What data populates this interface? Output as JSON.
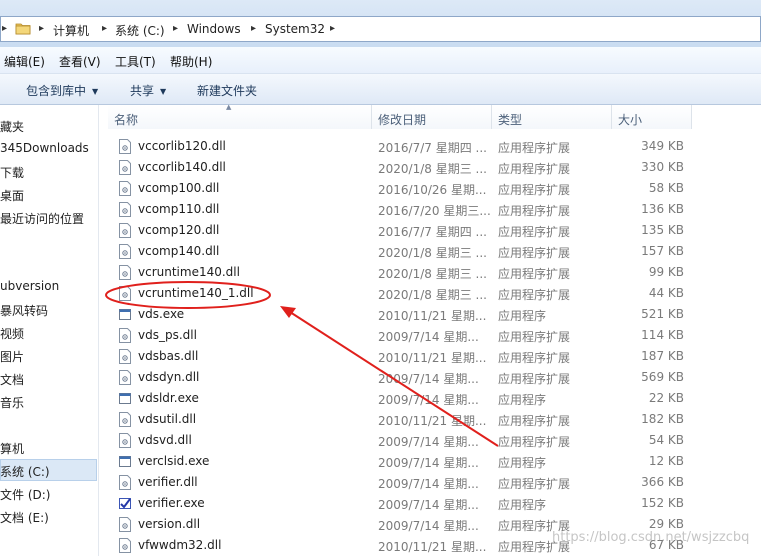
{
  "address_bar": {
    "crumbs": [
      "计算机",
      "系统 (C:)",
      "Windows",
      "System32"
    ]
  },
  "menu": [
    "编辑(E)",
    "查看(V)",
    "工具(T)",
    "帮助(H)"
  ],
  "commands": {
    "include_library": "包含到库中",
    "share": "共享",
    "new_folder": "新建文件夹"
  },
  "nav": {
    "items": [
      "藏夹",
      "345Downloads",
      "下载",
      "桌面",
      "最近访问的位置",
      "ubversion",
      "暴风转码",
      "视频",
      "图片",
      "文档",
      "音乐",
      "算机",
      "系统 (C:)",
      "文件 (D:)",
      "文档 (E:)"
    ]
  },
  "columns": {
    "name": "名称",
    "date": "修改日期",
    "type": "类型",
    "size": "大小"
  },
  "files": [
    {
      "name": "vccorlib120.dll",
      "date": "2016/7/7 星期四 ...",
      "type": "应用程序扩展",
      "size": "349 KB",
      "icon": "dll-icon"
    },
    {
      "name": "vccorlib140.dll",
      "date": "2020/1/8 星期三 ...",
      "type": "应用程序扩展",
      "size": "330 KB",
      "icon": "dll-icon"
    },
    {
      "name": "vcomp100.dll",
      "date": "2016/10/26 星期...",
      "type": "应用程序扩展",
      "size": "58 KB",
      "icon": "dll-icon"
    },
    {
      "name": "vcomp110.dll",
      "date": "2016/7/20 星期三...",
      "type": "应用程序扩展",
      "size": "136 KB",
      "icon": "dll-icon"
    },
    {
      "name": "vcomp120.dll",
      "date": "2016/7/7 星期四 ...",
      "type": "应用程序扩展",
      "size": "135 KB",
      "icon": "dll-icon"
    },
    {
      "name": "vcomp140.dll",
      "date": "2020/1/8 星期三 ...",
      "type": "应用程序扩展",
      "size": "157 KB",
      "icon": "dll-icon"
    },
    {
      "name": "vcruntime140.dll",
      "date": "2020/1/8 星期三 ...",
      "type": "应用程序扩展",
      "size": "99 KB",
      "icon": "dll-icon"
    },
    {
      "name": "vcruntime140_1.dll",
      "date": "2020/1/8 星期三 ...",
      "type": "应用程序扩展",
      "size": "44 KB",
      "icon": "dll-icon"
    },
    {
      "name": "vds.exe",
      "date": "2010/11/21 星期...",
      "type": "应用程序",
      "size": "521 KB",
      "icon": "exe-icon"
    },
    {
      "name": "vds_ps.dll",
      "date": "2009/7/14 星期...",
      "type": "应用程序扩展",
      "size": "114 KB",
      "icon": "dll-icon"
    },
    {
      "name": "vdsbas.dll",
      "date": "2010/11/21 星期...",
      "type": "应用程序扩展",
      "size": "187 KB",
      "icon": "dll-icon"
    },
    {
      "name": "vdsdyn.dll",
      "date": "2009/7/14 星期...",
      "type": "应用程序扩展",
      "size": "569 KB",
      "icon": "dll-icon"
    },
    {
      "name": "vdsldr.exe",
      "date": "2009/7/14 星期...",
      "type": "应用程序",
      "size": "22 KB",
      "icon": "exe-icon"
    },
    {
      "name": "vdsutil.dll",
      "date": "2010/11/21 星期...",
      "type": "应用程序扩展",
      "size": "182 KB",
      "icon": "dll-icon"
    },
    {
      "name": "vdsvd.dll",
      "date": "2009/7/14 星期...",
      "type": "应用程序扩展",
      "size": "54 KB",
      "icon": "dll-icon"
    },
    {
      "name": "verclsid.exe",
      "date": "2009/7/14 星期...",
      "type": "应用程序",
      "size": "12 KB",
      "icon": "exe-icon"
    },
    {
      "name": "verifier.dll",
      "date": "2009/7/14 星期...",
      "type": "应用程序扩展",
      "size": "366 KB",
      "icon": "dll-icon"
    },
    {
      "name": "verifier.exe",
      "date": "2009/7/14 星期...",
      "type": "应用程序",
      "size": "152 KB",
      "icon": "checkmark-icon"
    },
    {
      "name": "version.dll",
      "date": "2009/7/14 星期...",
      "type": "应用程序扩展",
      "size": "29 KB",
      "icon": "dll-icon"
    },
    {
      "name": "vfwwdm32.dll",
      "date": "2010/11/21 星期...",
      "type": "应用程序扩展",
      "size": "67 KB",
      "icon": "dll-icon"
    }
  ],
  "watermark": "https://blog.csdn.net/wsjzzcbq",
  "colors": {
    "annotation": "#e0201c",
    "selection": "#dbe8f6"
  }
}
